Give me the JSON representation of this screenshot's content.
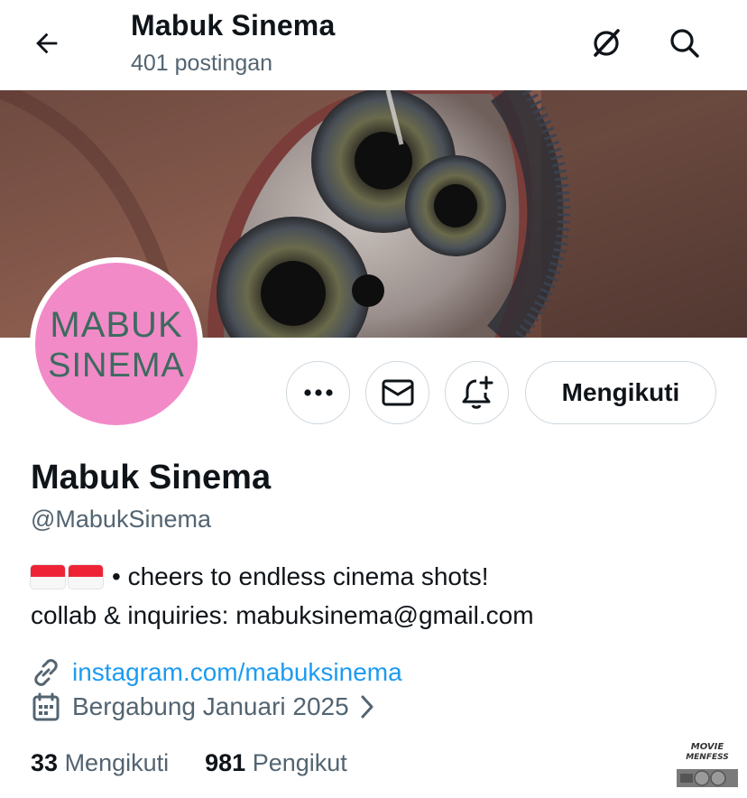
{
  "header": {
    "title": "Mabuk Sinema",
    "post_count": "401 postingan",
    "icons": [
      "back-arrow-icon",
      "grok-icon",
      "search-icon"
    ]
  },
  "avatar": {
    "line1": "MABUK",
    "line2": "SINEMA",
    "bg_color": "#f28ac8"
  },
  "actions": {
    "more_icon": "more-horizontal-icon",
    "message_icon": "envelope-icon",
    "notify_icon": "bell-plus-icon",
    "follow_label": "Mengikuti"
  },
  "profile": {
    "name": "Mabuk Sinema",
    "handle": "@MabukSinema",
    "bio_line1": "• cheers to endless cinema shots!",
    "bio_line2": "collab & inquiries: mabuksinema@gmail.com",
    "bio_flags": [
      "flag-singapore",
      "flag-indonesia"
    ],
    "link": "instagram.com/mabuksinema",
    "joined": "Bergabung Januari 2025"
  },
  "stats": {
    "following_count": "33",
    "following_label": "Mengikuti",
    "followers_count": "981",
    "followers_label": "Pengikut"
  },
  "watermark": {
    "line1": "MOVIE",
    "line2": "MENFESS"
  },
  "colors": {
    "text": "#0f1419",
    "secondary": "#536471",
    "link": "#1d9bf0",
    "border": "#cfd9de"
  }
}
